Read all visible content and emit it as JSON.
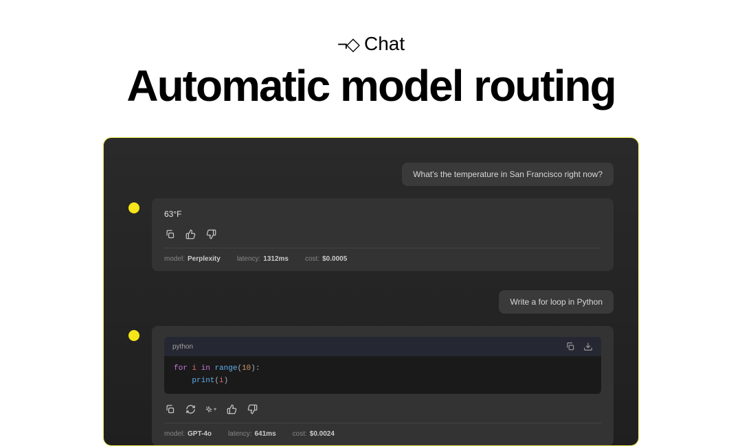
{
  "header": {
    "chat_label": "Chat",
    "title": "Automatic model routing"
  },
  "conversation": [
    {
      "user_message": "What's the temperature in San Francisco right now?",
      "assistant_answer": "63°F",
      "meta": {
        "model_label": "model:",
        "model_value": "Perplexity",
        "latency_label": "latency:",
        "latency_value": "1312ms",
        "cost_label": "cost:",
        "cost_value": "$0.0005"
      }
    },
    {
      "user_message": "Write a for loop in Python",
      "code_lang": "python",
      "code_line1_for": "for",
      "code_line1_i": "i",
      "code_line1_in": "in",
      "code_line1_range": "range",
      "code_line1_open": "(",
      "code_line1_num": "10",
      "code_line1_close": "):",
      "code_line2_indent": "    ",
      "code_line2_print": "print",
      "code_line2_open": "(",
      "code_line2_i": "i",
      "code_line2_close": ")",
      "meta": {
        "model_label": "model:",
        "model_value": "GPT-4o",
        "latency_label": "latency:",
        "latency_value": "641ms",
        "cost_label": "cost:",
        "cost_value": "$0.0024"
      }
    }
  ]
}
